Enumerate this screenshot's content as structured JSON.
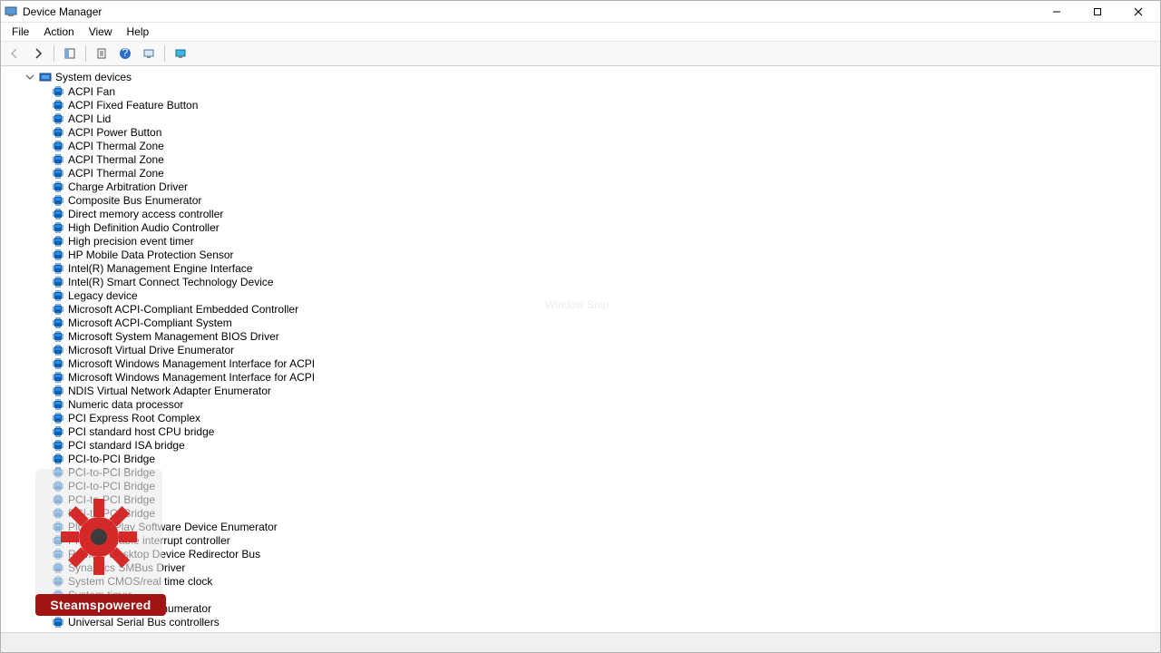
{
  "window": {
    "title": "Device Manager"
  },
  "menu": {
    "items": [
      "File",
      "Action",
      "View",
      "Help"
    ]
  },
  "toolbar": {
    "back": "back-icon",
    "forward": "forward-icon",
    "show_hide": "show-hide-icon",
    "properties": "properties-icon",
    "help": "help-icon",
    "refresh": "refresh-icon",
    "monitor": "monitor-icon"
  },
  "tree": {
    "category": "System devices",
    "expanded": true,
    "devices": [
      "ACPI Fan",
      "ACPI Fixed Feature Button",
      "ACPI Lid",
      "ACPI Power Button",
      "ACPI Thermal Zone",
      "ACPI Thermal Zone",
      "ACPI Thermal Zone",
      "Charge Arbitration Driver",
      "Composite Bus Enumerator",
      "Direct memory access controller",
      "High Definition Audio Controller",
      "High precision event timer",
      "HP Mobile Data Protection Sensor",
      "Intel(R) Management Engine Interface",
      "Intel(R) Smart Connect Technology Device",
      "Legacy device",
      "Microsoft ACPI-Compliant Embedded Controller",
      "Microsoft ACPI-Compliant System",
      "Microsoft System Management BIOS Driver",
      "Microsoft Virtual Drive Enumerator",
      "Microsoft Windows Management Interface for ACPI",
      "Microsoft Windows Management Interface for ACPI",
      "NDIS Virtual Network Adapter Enumerator",
      "Numeric data processor",
      "PCI Express Root Complex",
      "PCI standard host CPU bridge",
      "PCI standard ISA bridge",
      "PCI-to-PCI Bridge",
      "PCI-to-PCI Bridge",
      "PCI-to-PCI Bridge",
      "PCI-to-PCI Bridge",
      "PCI-to-PCI Bridge",
      "Plug and Play Software Device Enumerator",
      "Programmable interrupt controller",
      "Remote Desktop Device Redirector Bus",
      "Synaptics SMBus Driver",
      "System CMOS/real time clock",
      "System timer",
      "UMBus Root Bus Enumerator",
      "Universal Serial Bus controllers"
    ]
  },
  "overlay": {
    "label": "Steamspowered"
  },
  "watermark": {
    "text": "Window Snip"
  }
}
